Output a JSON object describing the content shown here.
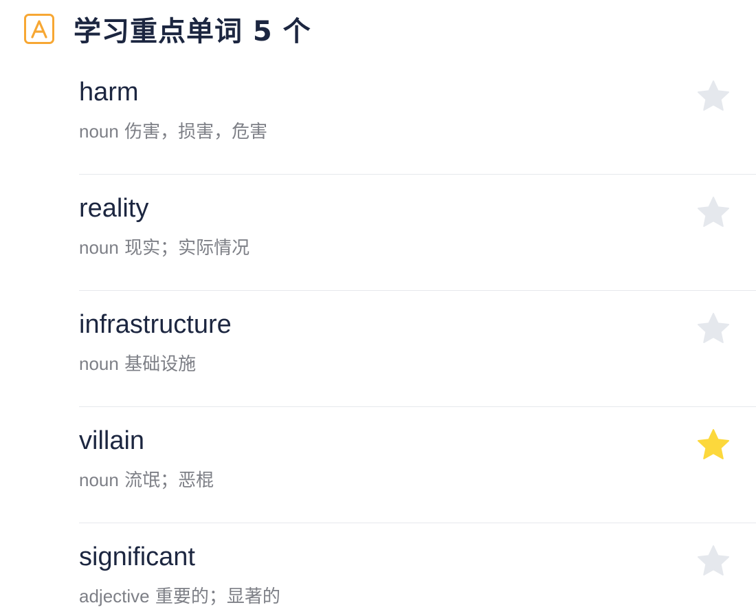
{
  "header": {
    "badge_letter": "A",
    "badge_color": "#f7a733",
    "title": "学习重点单词 5 个"
  },
  "colors": {
    "star_off": "#e5e8ed",
    "star_on": "#fcd83c"
  },
  "words": [
    {
      "word": "harm",
      "pos": "noun",
      "meaning": "伤害，损害，危害",
      "starred": false
    },
    {
      "word": "reality",
      "pos": "noun",
      "meaning": "现实；实际情况",
      "starred": false
    },
    {
      "word": "infrastructure",
      "pos": "noun",
      "meaning": "基础设施",
      "starred": false
    },
    {
      "word": "villain",
      "pos": "noun",
      "meaning": "流氓；恶棍",
      "starred": true
    },
    {
      "word": "significant",
      "pos": "adjective",
      "meaning": "重要的；显著的",
      "starred": false
    }
  ]
}
